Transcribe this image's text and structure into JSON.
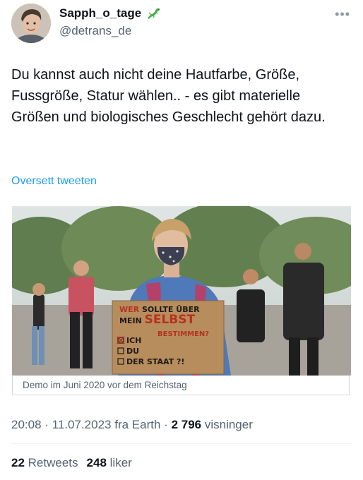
{
  "author": {
    "display_name": "Sapph_o_tage",
    "handle": "@detrans_de",
    "name_emoji": "lizard-emoji"
  },
  "tweet": {
    "text": "Du kannst auch nicht deine Hautfarbe, Größe, Fussgröße, Statur wählen.. - es gibt materielle Größen und biologisches Geschlecht gehört dazu.",
    "translate_label": "Oversett tweeten"
  },
  "media": {
    "caption": "Demo im Juni 2020 vor dem Reichstag",
    "sign_lines": [
      "WER SOLLTE ÜBER",
      "MEIN SELBST",
      "BESTIMMEN?",
      "ICH",
      "DU",
      "DER STAAT ?!"
    ]
  },
  "meta": {
    "time": "20:08",
    "date": "11.07.2023",
    "source": "fra Earth",
    "views_count": "2 796",
    "views_label": "visninger"
  },
  "stats": {
    "retweets_count": "22",
    "retweets_label": "Retweets",
    "likes_count": "248",
    "likes_label": "liker"
  },
  "colors": {
    "accent": "#1d9bf0",
    "secondary_text": "#536471",
    "primary_text": "#0f1419"
  },
  "icons": {
    "more": "more-dots-icon"
  }
}
